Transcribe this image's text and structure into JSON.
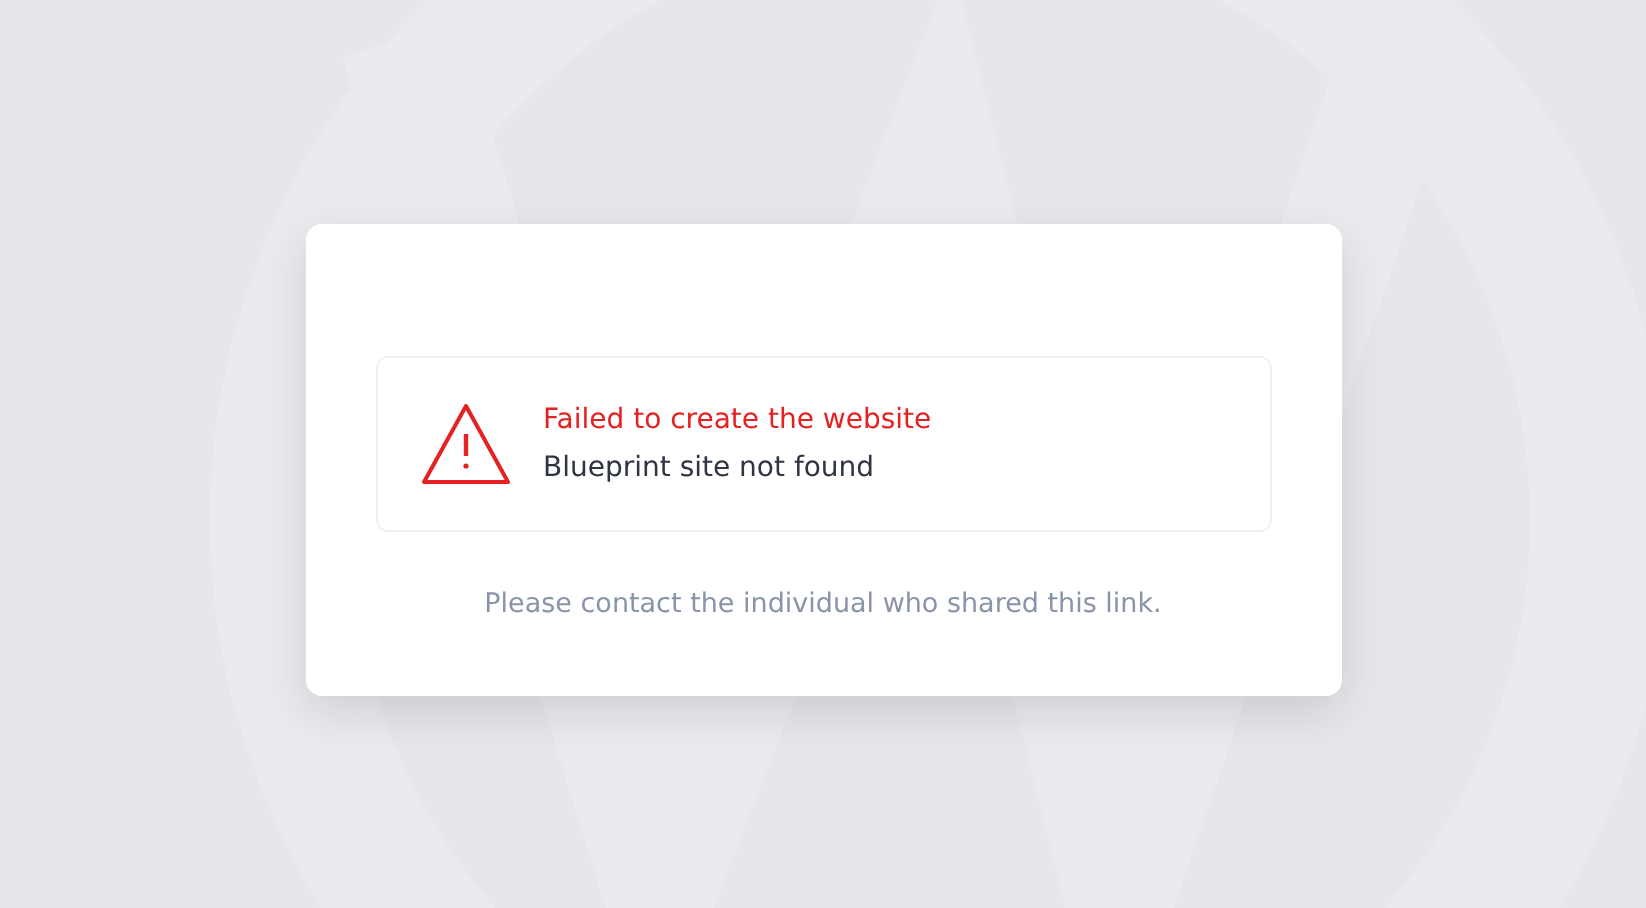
{
  "error": {
    "title": "Failed to create the website",
    "message": "Blueprint site not found"
  },
  "footer": "Please contact the individual who shared this link."
}
